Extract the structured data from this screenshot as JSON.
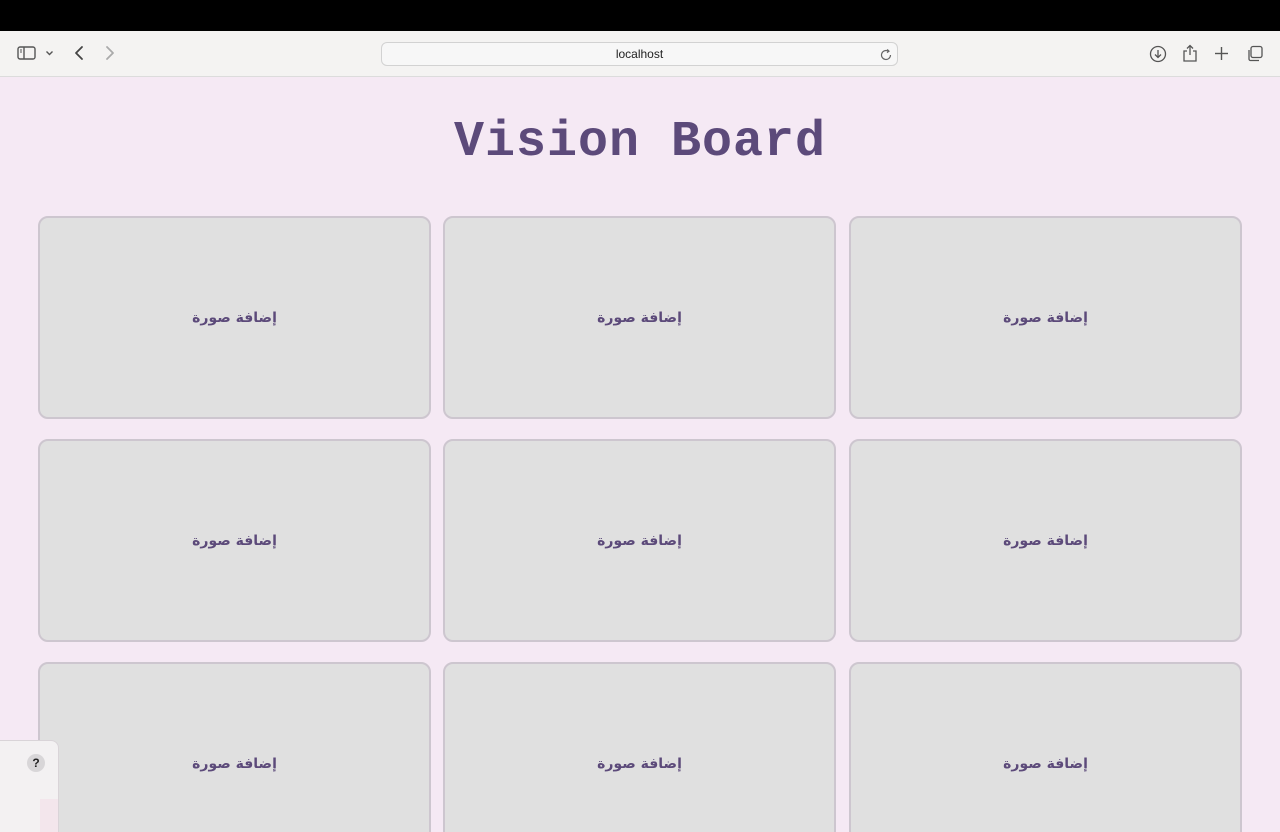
{
  "browser": {
    "url": "localhost"
  },
  "page": {
    "title": "Vision Board",
    "tiles": [
      {
        "label": "إضافة صورة"
      },
      {
        "label": "إضافة صورة"
      },
      {
        "label": "إضافة صورة"
      },
      {
        "label": "إضافة صورة"
      },
      {
        "label": "إضافة صورة"
      },
      {
        "label": "إضافة صورة"
      },
      {
        "label": "إضافة صورة"
      },
      {
        "label": "إضافة صورة"
      },
      {
        "label": "إضافة صورة"
      }
    ]
  },
  "help": {
    "label": "?"
  },
  "colors": {
    "background": "#f5e9f4",
    "title": "#5c4a7a",
    "tile_background": "#e0e0e0",
    "tile_border": "#cdc6cf"
  }
}
